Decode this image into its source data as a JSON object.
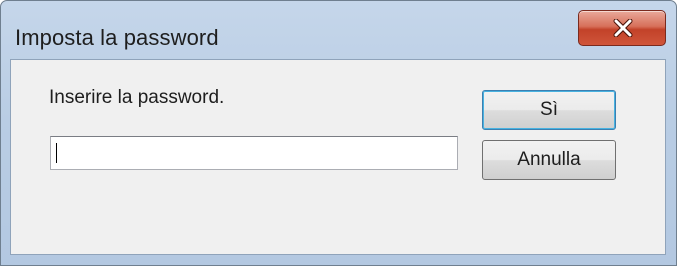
{
  "window": {
    "title": "Imposta la password"
  },
  "dialog": {
    "prompt": "Inserire la password.",
    "password_value": "",
    "yes_label": "Sì",
    "cancel_label": "Annulla"
  },
  "icons": {
    "close": "close-icon"
  }
}
